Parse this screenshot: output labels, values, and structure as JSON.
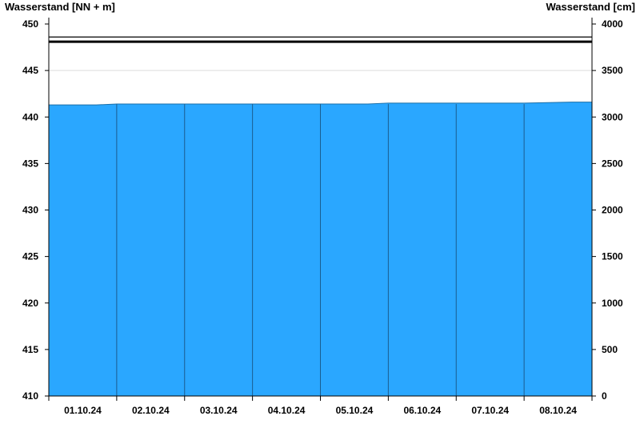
{
  "chart_data": {
    "type": "area",
    "y_left_label": "Wasserstand [NN + m]",
    "y_right_label": "Wasserstand [cm]",
    "y_left_range": [
      410,
      450
    ],
    "y_left_ticks": [
      "410",
      "415",
      "420",
      "425",
      "430",
      "435",
      "440",
      "445",
      "450"
    ],
    "y_right_range": [
      0,
      4000
    ],
    "y_right_ticks": [
      "0",
      "500",
      "1000",
      "1500",
      "2000",
      "2500",
      "3000",
      "3500",
      "4000"
    ],
    "x_labels": [
      "01.10.24",
      "02.10.24",
      "03.10.24",
      "04.10.24",
      "05.10.24",
      "06.10.24",
      "07.10.24",
      "08.10.24"
    ],
    "x_domain": [
      0,
      8
    ],
    "grid": true,
    "series": [
      {
        "color": "#2aa7ff",
        "x": [
          0,
          0.7,
          1,
          2,
          3,
          4,
          4.7,
          5,
          6,
          7,
          7.7,
          8
        ],
        "values": [
          441.3,
          441.3,
          441.4,
          441.4,
          441.4,
          441.4,
          441.4,
          441.5,
          441.5,
          441.5,
          441.6,
          441.6
        ]
      }
    ],
    "reference_lines": [
      {
        "value": 448.6,
        "color": "#000000",
        "weight": "thin"
      },
      {
        "value": 448.1,
        "color": "#000000",
        "weight": "thick"
      }
    ]
  }
}
